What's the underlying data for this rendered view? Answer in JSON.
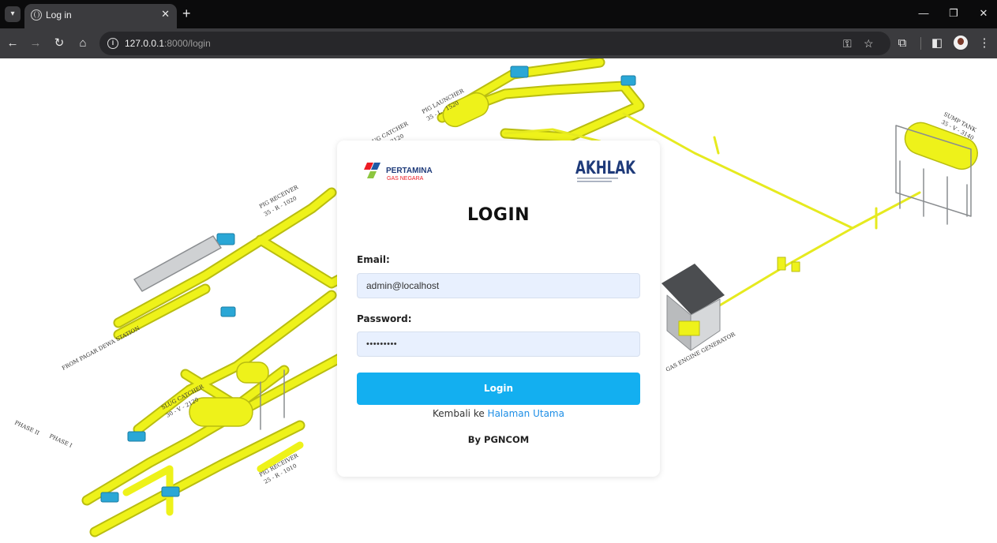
{
  "browser": {
    "tab_title": "Log in",
    "url_host": "127.0.0.1",
    "url_path": ":8000/login",
    "icons": {
      "tab_menu": "chevron-down-icon",
      "favicon": "globe-icon",
      "close": "close-icon",
      "new_tab": "plus-icon",
      "back": "arrow-left-icon",
      "forward": "arrow-right-icon",
      "reload": "reload-icon",
      "home": "home-icon",
      "site_info": "info-icon",
      "password_key": "key-icon",
      "bookmark": "star-icon",
      "extensions": "puzzle-icon",
      "side_panel": "side-panel-icon",
      "profile": "avatar",
      "menu": "kebab-menu-icon"
    }
  },
  "page": {
    "logos": {
      "pertamina_name": "PERTAMINA",
      "pertamina_sub": "GAS NEGARA",
      "akhlak": "AKHLAK"
    },
    "title": "LOGIN",
    "email_label": "Email:",
    "email_value": "admin@localhost",
    "password_label": "Password:",
    "password_value": "•••••••••",
    "login_button": "Login",
    "back_text": "Kembali ke",
    "back_link": "Halaman Utama",
    "footer": "By PGNCOM"
  },
  "background": {
    "labels": [
      "PIG RECEIVER",
      "35 - R - 1020",
      "SLUG CATCHER",
      "30 - V - 2120",
      "PIG LAUNCHER",
      "35 - L - 1520",
      "SUMP TANK",
      "35 - V - 3140",
      "GAS ENGINE GENERATOR",
      "FROM PAGAR DEWA STATION",
      "SLUG CATCHER",
      "30 - V - 2120",
      "PIG RECEIVER",
      "25 - R - 1010",
      "PHASE II",
      "PHASE I"
    ],
    "colors": {
      "pipe": "#eef21a",
      "pipe_shadow": "#b9bd10",
      "valve": "#2aa7d6",
      "steel": "#8a8d90"
    }
  }
}
